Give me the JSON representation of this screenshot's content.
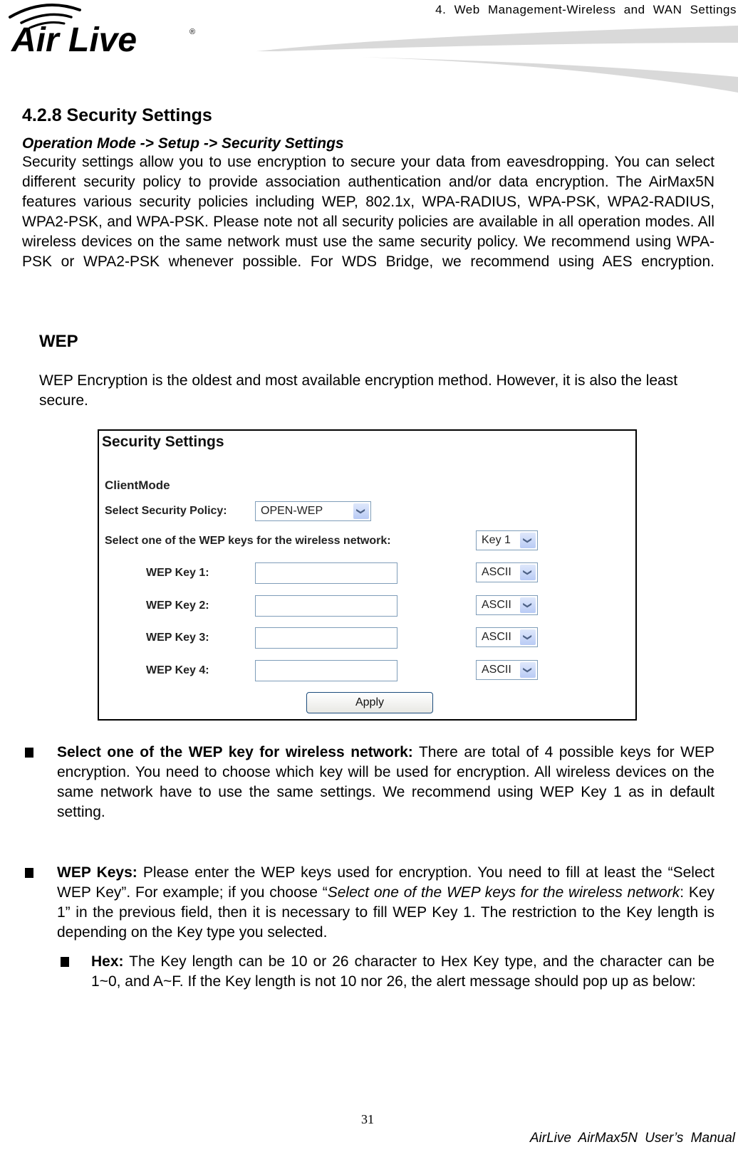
{
  "header": {
    "chapter": "4. Web Management-Wireless and WAN Settings",
    "logo_text": "Air Live",
    "logo_mark": "®"
  },
  "section": {
    "title": "4.2.8 Security Settings",
    "breadcrumb": "Operation Mode -> Setup -> Security Settings",
    "intro": "Security settings allow you to use encryption to secure your data from eavesdropping. You can select different security policy to provide association authentication and/or data encryption. The AirMax5N features various security policies including WEP, 802.1x, WPA-RADIUS, WPA-PSK, WPA2-RADIUS, WPA2-PSK, and WPA-PSK. Please note not all security policies are available in all operation modes. All wireless devices on the same network must use the same security policy. We recommend using WPA-PSK or WPA2-PSK whenever possible. For WDS Bridge, we recommend using AES encryption."
  },
  "wep": {
    "heading": "WEP",
    "description": "WEP Encryption is the oldest and most available encryption method. However, it is also the least secure."
  },
  "panel": {
    "title": "Security Settings",
    "mode": "ClientMode",
    "policy_label": "Select Security Policy:",
    "policy_value": "OPEN-WEP",
    "key_select_label": "Select one of the WEP keys for the wireless network:",
    "key_select_value": "Key 1",
    "keys": [
      {
        "label": "WEP Key 1:",
        "value": "",
        "type": "ASCII"
      },
      {
        "label": "WEP Key 2:",
        "value": "",
        "type": "ASCII"
      },
      {
        "label": "WEP Key 3:",
        "value": "",
        "type": "ASCII"
      },
      {
        "label": "WEP Key 4:",
        "value": "",
        "type": "ASCII"
      }
    ],
    "apply_label": "Apply",
    "arrow_glyph": "❯"
  },
  "bullets": [
    {
      "bold": "Select one of the WEP key for wireless network:",
      "text": " There are total of 4 possible keys for WEP encryption. You need to choose which key will be used for encryption. All wireless devices on the same network have to use the same settings. We recommend using WEP Key 1 as in default setting."
    },
    {
      "bold": "WEP Keys:",
      "text_a": " Please enter the WEP keys used for encryption. You need to fill at least the “Select WEP Key”. For example; if you choose “",
      "italic": "Select one of the WEP keys for the wireless network",
      "text_b": ": Key 1” in the previous field, then it is necessary to fill WEP Key 1. The restriction to the Key length is depending on the Key type you selected."
    }
  ],
  "sub_bullets": [
    {
      "bold": "Hex:",
      "text": " The Key length can be 10 or 26 character to Hex Key type, and the character can be 1~0, and A~F. If the Key length is not 10 nor 26, the alert message should pop up as below:"
    }
  ],
  "footer": {
    "page_number": "31",
    "manual": "AirLive AirMax5N User’s Manual"
  }
}
